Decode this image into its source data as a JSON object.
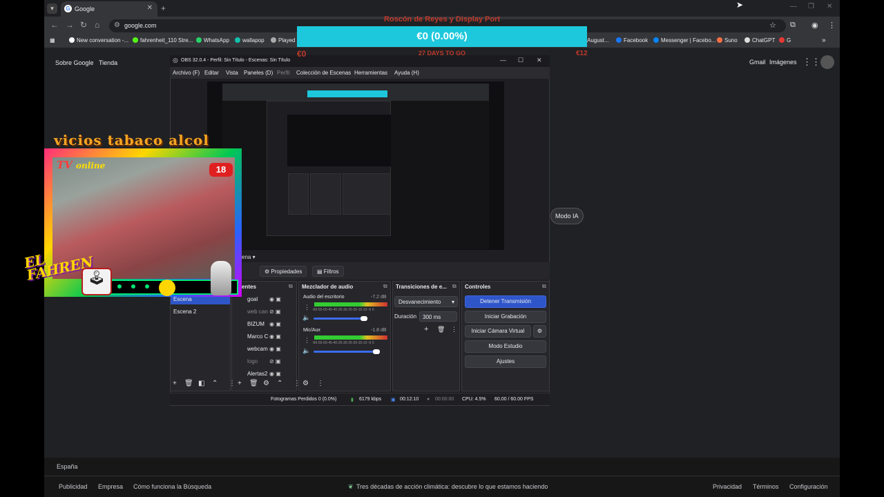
{
  "browser": {
    "tab_title": "Google",
    "url": "google.com",
    "bookmarks": [
      "New conversation -...",
      "fahrenheit_110 Stre...",
      "WhatsApp",
      "wallapop",
      "Played",
      "August...",
      "Facebook",
      "Messenger | Facebo...",
      "Suno",
      "ChatGPT",
      "G"
    ]
  },
  "google": {
    "top_left": [
      "Sobre Google",
      "Tienda"
    ],
    "top_right": [
      "Gmail",
      "Imágenes"
    ],
    "modo_ia": "Modo IA",
    "country": "España",
    "footer_left": [
      "Publicidad",
      "Empresa",
      "Cómo funciona la Búsqueda"
    ],
    "footer_center": "Tres décadas de acción climática: descubre lo que estamos haciendo",
    "footer_right": [
      "Privacidad",
      "Términos",
      "Configuración"
    ]
  },
  "donation": {
    "title": "Roscón de Reyes y Display Port",
    "amount": "€0 (0.00%)",
    "start": "€0",
    "days": "27 DAYS TO GO",
    "goal": "€12",
    "progress_percent": 0
  },
  "overlay": {
    "banner": "vicios tabaco alcol",
    "tv": "TV",
    "tv_online": "online",
    "age": "18",
    "logo_line1": "EL",
    "logo_line2": "FAHREN"
  },
  "obs": {
    "title": "OBS 32.0.4 - Perfil: Sin Título - Escenas: Sin Título",
    "menu": [
      "Archivo (F)",
      "Editar",
      "Vista",
      "Paneles (D)",
      "Perfil",
      "Colección de Escenas",
      "Herramientas",
      "Ayuda (H)"
    ],
    "dock_properties": "Propiedades",
    "dock_filters": "Filtros",
    "scenes_label": "ena",
    "scenes": [
      "Escena",
      "Escena 2"
    ],
    "sources_header": "entes",
    "sources": [
      "goal",
      "web can",
      "BIZUM",
      "Marco C",
      "webcam",
      "logo",
      "Alertas2"
    ],
    "mixer_header": "Mezclador de audio",
    "mixer": [
      {
        "name": "Audio del escritorio",
        "db": "-7.2 dB",
        "level": 0.7
      },
      {
        "name": "Mic/Aux",
        "db": "-1.8 dB",
        "level": 0.85
      }
    ],
    "meter_scale": "-60-55-50-45-40-35-30-25-20-15-10 -5 0",
    "transitions_header": "Transiciones de e...",
    "transition": "Desvanecimiento",
    "duration_label": "Duración",
    "duration": "300 ms",
    "controls_header": "Controles",
    "controls": [
      "Detener Transmisión",
      "Iniciar Grabación",
      "Iniciar Cámara Virtual",
      "Modo Estudio",
      "Ajustes"
    ],
    "status": {
      "dropped": "Fotogramas Perdidos 0 (0.0%)",
      "bitrate": "6179 kbps",
      "stream_time": "00:12:10",
      "rec_time": "00:00:00",
      "cpu": "CPU: 4.5%",
      "fps": "60.00 / 60.00 FPS"
    }
  }
}
